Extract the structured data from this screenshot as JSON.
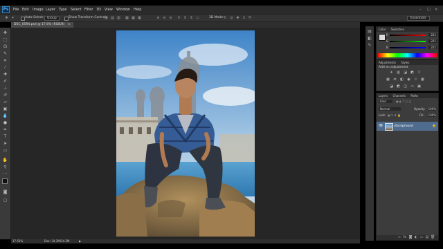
{
  "app": {
    "logo": "Ps"
  },
  "menus": [
    "File",
    "Edit",
    "Image",
    "Layer",
    "Type",
    "Select",
    "Filter",
    "3D",
    "View",
    "Window",
    "Help"
  ],
  "options": {
    "auto_select": "Auto-Select:",
    "group": "Group",
    "show_transform": "Show Transform Controls",
    "mode_3d": "3D Mode:",
    "workspace": "Essentials"
  },
  "document": {
    "tab_label": "DSC_0594.psd @ 17.6% (RGB/8)",
    "zoom": "17.55%",
    "doc_size": "Doc: 34.3M/34.3M"
  },
  "color_panel": {
    "tabs": [
      "Color",
      "Swatches"
    ],
    "r": "221",
    "g": "221",
    "b": "221",
    "r_label": "R",
    "g_label": "G",
    "b_label": "B"
  },
  "adjustments_panel": {
    "tabs": [
      "Adjustments",
      "Styles"
    ],
    "subtitle": "Add an adjustment"
  },
  "layers_panel": {
    "tabs": [
      "Layers",
      "Channels",
      "Paths"
    ],
    "kind": "Kind",
    "blend_mode": "Normal",
    "opacity_label": "Opacity:",
    "opacity": "100%",
    "lock_label": "Lock:",
    "fill_label": "Fill:",
    "fill": "100%",
    "layer_name": "Background"
  },
  "colors": {
    "accent": "#4f6c8e",
    "bg": "#262626"
  }
}
